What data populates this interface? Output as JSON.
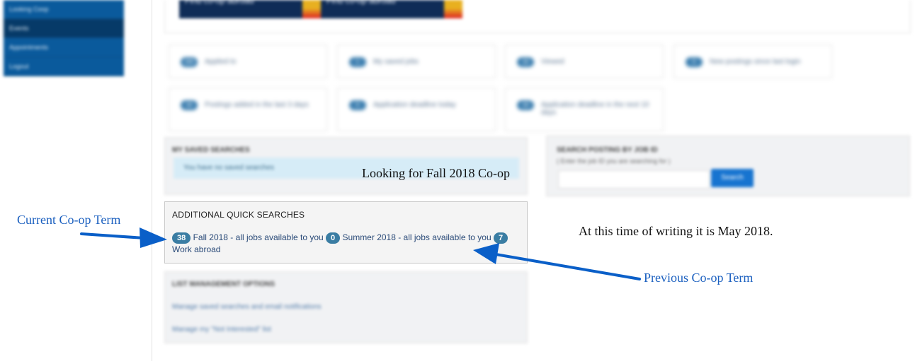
{
  "sidebar": {
    "items": [
      {
        "label": "Looking Coop"
      },
      {
        "label": "Events"
      },
      {
        "label": "Appointments"
      },
      {
        "label": "Logout"
      }
    ]
  },
  "banners": [
    {
      "label": "Find co-op abroad"
    },
    {
      "label": "Find co-op abroad"
    }
  ],
  "tiles": [
    {
      "count": "160",
      "label": "Applied to"
    },
    {
      "count": "1",
      "label": "My saved jobs"
    },
    {
      "count": "16",
      "label": "Viewed"
    },
    {
      "count": "0",
      "label": "New postings since last login"
    },
    {
      "count": "16",
      "label": "Postings added in the last 3 days"
    },
    {
      "count": "0",
      "label": "Application deadline today"
    },
    {
      "count": "16",
      "label": "Application deadline in the next 10 days"
    }
  ],
  "saved_searches": {
    "title": "MY SAVED SEARCHES",
    "empty_text": "You have no saved searches"
  },
  "search_by_id": {
    "title": "SEARCH POSTING BY JOB ID",
    "subtitle": "( Enter the job ID you are searching for )",
    "button": "Search"
  },
  "quick_searches": {
    "title": "ADDITIONAL QUICK SEARCHES",
    "items": [
      {
        "count": "38",
        "label": "Fall 2018 - all jobs available to you"
      },
      {
        "count": "0",
        "label": "Summer 2018 - all jobs available to you"
      },
      {
        "count": "7",
        "label": "Work abroad"
      }
    ]
  },
  "list_management": {
    "title": "LIST MANAGEMENT OPTIONS",
    "links": [
      "Manage saved searches and email notifications",
      "Manage my \"Not Interested\" list"
    ]
  },
  "annotations": {
    "looking_for": "Looking for Fall 2018 Co-op",
    "current_term": "Current Co-op Term",
    "previous_term": "Previous Co-op Term",
    "writing_date": "At this time of writing it is May 2018."
  },
  "colors": {
    "annotation_blue": "#1a5fbf",
    "badge": "#3a7da3",
    "sidebar": "#0a5a9c"
  }
}
